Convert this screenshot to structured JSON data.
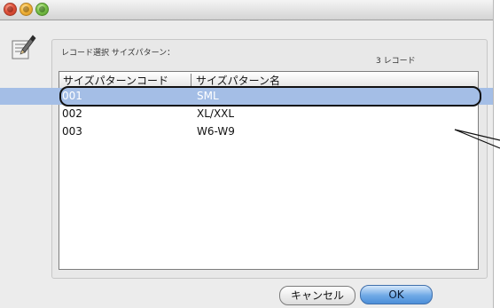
{
  "window": {
    "title": ""
  },
  "header": {
    "label": "レコード選択  サイズパターン：",
    "record_count": "3 レコード"
  },
  "table": {
    "columns": [
      "サイズパターンコード",
      "サイズパターン名"
    ],
    "rows": [
      {
        "code": "001",
        "name": "SML",
        "selected": true
      },
      {
        "code": "002",
        "name": "XL/XXL",
        "selected": false
      },
      {
        "code": "003",
        "name": "W6-W9",
        "selected": false
      }
    ]
  },
  "buttons": {
    "cancel": "キャンセル",
    "ok": "OK"
  },
  "colors": {
    "selection": "#a4bee6",
    "window_bg": "#ececec",
    "ok_button": "#6fa9e6"
  },
  "icons": {
    "app": "pencil-paper-icon"
  }
}
